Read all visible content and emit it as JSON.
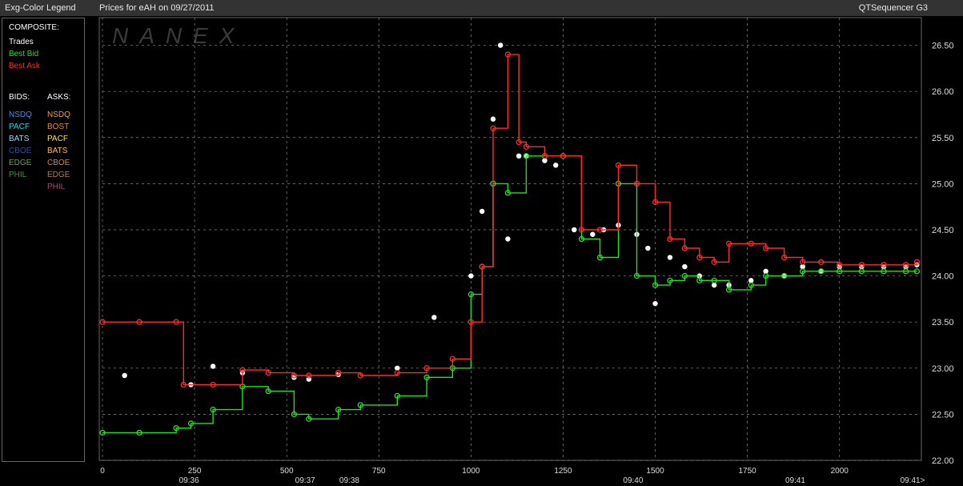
{
  "header": {
    "legend_title": "Exg-Color Legend",
    "chart_title": "Prices for  eAH  on  09/27/2011",
    "app_name": "QTSequencer G3"
  },
  "legend": {
    "composite_heading": "COMPOSITE:",
    "composite": [
      {
        "label": "Trades",
        "color": "#ffffff"
      },
      {
        "label": "Best Bid",
        "color": "#22e022"
      },
      {
        "label": "Best Ask",
        "color": "#ff2a2a"
      }
    ],
    "bids_heading": "BIDS:",
    "asks_heading": "ASKS:",
    "bids": [
      {
        "label": "NSDQ",
        "color": "#3f8fff"
      },
      {
        "label": "PACF",
        "color": "#22d8e8"
      },
      {
        "label": "BATS",
        "color": "#9fd8ff"
      },
      {
        "label": "CBOE",
        "color": "#1f4fc0"
      },
      {
        "label": "EDGE",
        "color": "#5aa85a"
      },
      {
        "label": "PHIL",
        "color": "#3f8f3f"
      }
    ],
    "asks": [
      {
        "label": "NSDQ",
        "color": "#ff9b3a"
      },
      {
        "label": "BOST",
        "color": "#e08a5a"
      },
      {
        "label": "PACF",
        "color": "#ffe23a"
      },
      {
        "label": "BATS",
        "color": "#ffc04a"
      },
      {
        "label": "CBOE",
        "color": "#d08a3a"
      },
      {
        "label": "EDGE",
        "color": "#b07a5a"
      },
      {
        "label": "PHIL",
        "color": "#b0407a"
      }
    ]
  },
  "watermark": "NANEX",
  "chart_data": {
    "type": "line",
    "title": "Prices for  eAH  on  09/27/2011",
    "xlim": [
      0,
      2220
    ],
    "ylim": [
      22.0,
      26.8
    ],
    "x_ticks": [
      0,
      250,
      500,
      750,
      1000,
      1250,
      1500,
      1750,
      2000
    ],
    "y_ticks": [
      22.0,
      22.5,
      23.0,
      23.5,
      24.0,
      24.5,
      25.0,
      25.5,
      26.0,
      26.5
    ],
    "y_tick_labels": [
      "22.00",
      "22.50",
      "23.00",
      "23.50",
      "24.00",
      "24.50",
      "25.00",
      "25.50",
      "26.00",
      "26.50"
    ],
    "time_labels": [
      {
        "x": 235,
        "label": "09:36"
      },
      {
        "x": 550,
        "label": "09:37"
      },
      {
        "x": 670,
        "label": "09:38"
      },
      {
        "x": 1440,
        "label": "09:40"
      },
      {
        "x": 1880,
        "label": "09:41"
      },
      {
        "x": 2200,
        "label": "09:41>"
      }
    ],
    "grid": true,
    "series": [
      {
        "name": "Trades",
        "color": "#ffffff",
        "x": [
          60,
          240,
          300,
          380,
          520,
          560,
          640,
          800,
          900,
          1000,
          1030,
          1060,
          1080,
          1100,
          1130,
          1150,
          1200,
          1230,
          1280,
          1330,
          1360,
          1400,
          1450,
          1480,
          1500,
          1540,
          1580,
          1620,
          1660,
          1700,
          1760,
          1800,
          1850,
          1900,
          1950,
          2000,
          2060,
          2120,
          2180,
          2210
        ],
        "y": [
          22.92,
          22.82,
          23.02,
          22.95,
          22.9,
          22.88,
          22.93,
          23.0,
          23.55,
          24.0,
          24.7,
          25.7,
          26.5,
          24.4,
          25.3,
          25.3,
          25.25,
          25.2,
          24.5,
          24.45,
          24.5,
          24.55,
          24.45,
          24.3,
          23.7,
          24.2,
          24.1,
          24.0,
          23.9,
          23.9,
          23.95,
          24.05,
          24.0,
          24.1,
          24.05,
          24.1,
          24.1,
          24.1,
          24.1,
          24.12
        ]
      },
      {
        "name": "Best Bid",
        "color": "#22e022",
        "x": [
          0,
          100,
          200,
          240,
          300,
          380,
          450,
          520,
          560,
          640,
          700,
          800,
          880,
          950,
          1000,
          1030,
          1060,
          1100,
          1150,
          1200,
          1250,
          1300,
          1350,
          1400,
          1450,
          1500,
          1540,
          1580,
          1620,
          1660,
          1700,
          1760,
          1800,
          1850,
          1900,
          1950,
          2000,
          2060,
          2120,
          2180,
          2210
        ],
        "y": [
          22.3,
          22.3,
          22.35,
          22.4,
          22.55,
          22.8,
          22.75,
          22.5,
          22.45,
          22.55,
          22.6,
          22.7,
          22.9,
          23.0,
          23.8,
          24.1,
          25.0,
          24.9,
          25.3,
          25.3,
          25.3,
          24.4,
          24.2,
          25.0,
          24.0,
          23.9,
          23.95,
          24.0,
          23.95,
          23.95,
          23.85,
          23.9,
          24.0,
          24.0,
          24.05,
          24.05,
          24.05,
          24.05,
          24.05,
          24.05,
          24.05
        ]
      },
      {
        "name": "Best Ask",
        "color": "#ff2a2a",
        "x": [
          0,
          100,
          200,
          220,
          300,
          380,
          450,
          520,
          560,
          640,
          700,
          800,
          880,
          950,
          1000,
          1030,
          1060,
          1100,
          1130,
          1150,
          1200,
          1250,
          1300,
          1350,
          1400,
          1450,
          1500,
          1540,
          1580,
          1620,
          1660,
          1700,
          1760,
          1800,
          1850,
          1900,
          1950,
          2000,
          2060,
          2120,
          2180,
          2210
        ],
        "y": [
          23.5,
          23.5,
          23.5,
          22.82,
          22.82,
          22.98,
          22.95,
          22.92,
          22.92,
          22.95,
          22.92,
          22.95,
          23.0,
          23.1,
          23.5,
          24.1,
          25.6,
          26.4,
          25.45,
          25.4,
          25.3,
          25.3,
          24.5,
          24.5,
          25.2,
          25.0,
          24.8,
          24.4,
          24.3,
          24.2,
          24.15,
          24.35,
          24.35,
          24.3,
          24.2,
          24.15,
          24.15,
          24.12,
          24.12,
          24.12,
          24.12,
          24.15
        ]
      }
    ]
  }
}
